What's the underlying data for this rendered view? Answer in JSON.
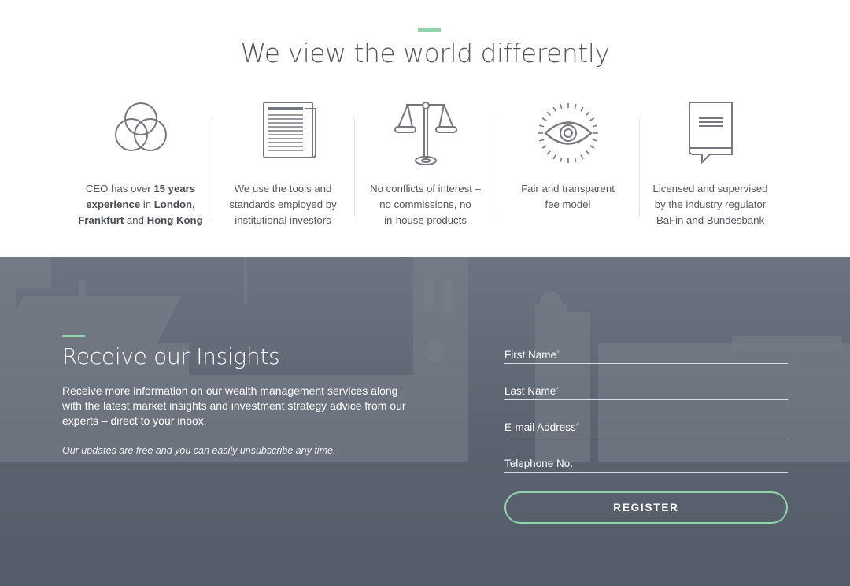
{
  "header": {
    "title": "We view the world differently"
  },
  "features": [
    {
      "icon": "venn-circles-icon",
      "parts": [
        {
          "text": "CEO has over ",
          "bold": false
        },
        {
          "text": "15 years",
          "bold": true
        },
        {
          "text": " experience",
          "bold": false
        },
        {
          "text": " in ",
          "bold": false
        },
        {
          "text": "London,",
          "bold": true
        },
        {
          "text": "Frankfurt",
          "bold": true
        },
        {
          "text": " and ",
          "bold": false
        },
        {
          "text": "Hong Kong",
          "bold": true
        }
      ],
      "lines": [
        "CEO has over 15 years",
        "experience in London,",
        "Frankfurt and Hong Kong"
      ]
    },
    {
      "icon": "newspaper-icon",
      "lines": [
        "We use the tools and",
        "standards employed by",
        "institutional investors"
      ]
    },
    {
      "icon": "scales-icon",
      "lines": [
        "No conflicts of interest –",
        "no commissions, no",
        "in-house products"
      ]
    },
    {
      "icon": "eye-icon",
      "lines": [
        "Fair and transparent",
        "fee model"
      ]
    },
    {
      "icon": "book-speech-icon",
      "lines": [
        "Licensed and supervised",
        "by the industry regulator",
        "BaFin and Bundesbank"
      ]
    }
  ],
  "insights": {
    "title": "Receive our Insights",
    "text": "Receive more information on our wealth management services along with the latest market insights and investment strategy advice from our experts – direct to your inbox.",
    "note": "Our updates are free and you can easily unsubscribe any time."
  },
  "form": {
    "fields": [
      {
        "label": "First Name",
        "required": true,
        "value": ""
      },
      {
        "label": "Last Name",
        "required": true,
        "value": ""
      },
      {
        "label": "E-mail Address",
        "required": true,
        "value": ""
      },
      {
        "label": "Telephone No.",
        "required": false,
        "value": ""
      }
    ],
    "required_marker": "*",
    "submit_label": "REGISTER"
  },
  "colors": {
    "accent": "#8fd5a7",
    "dark_bg": "#5a6170",
    "text": "#55585d"
  }
}
